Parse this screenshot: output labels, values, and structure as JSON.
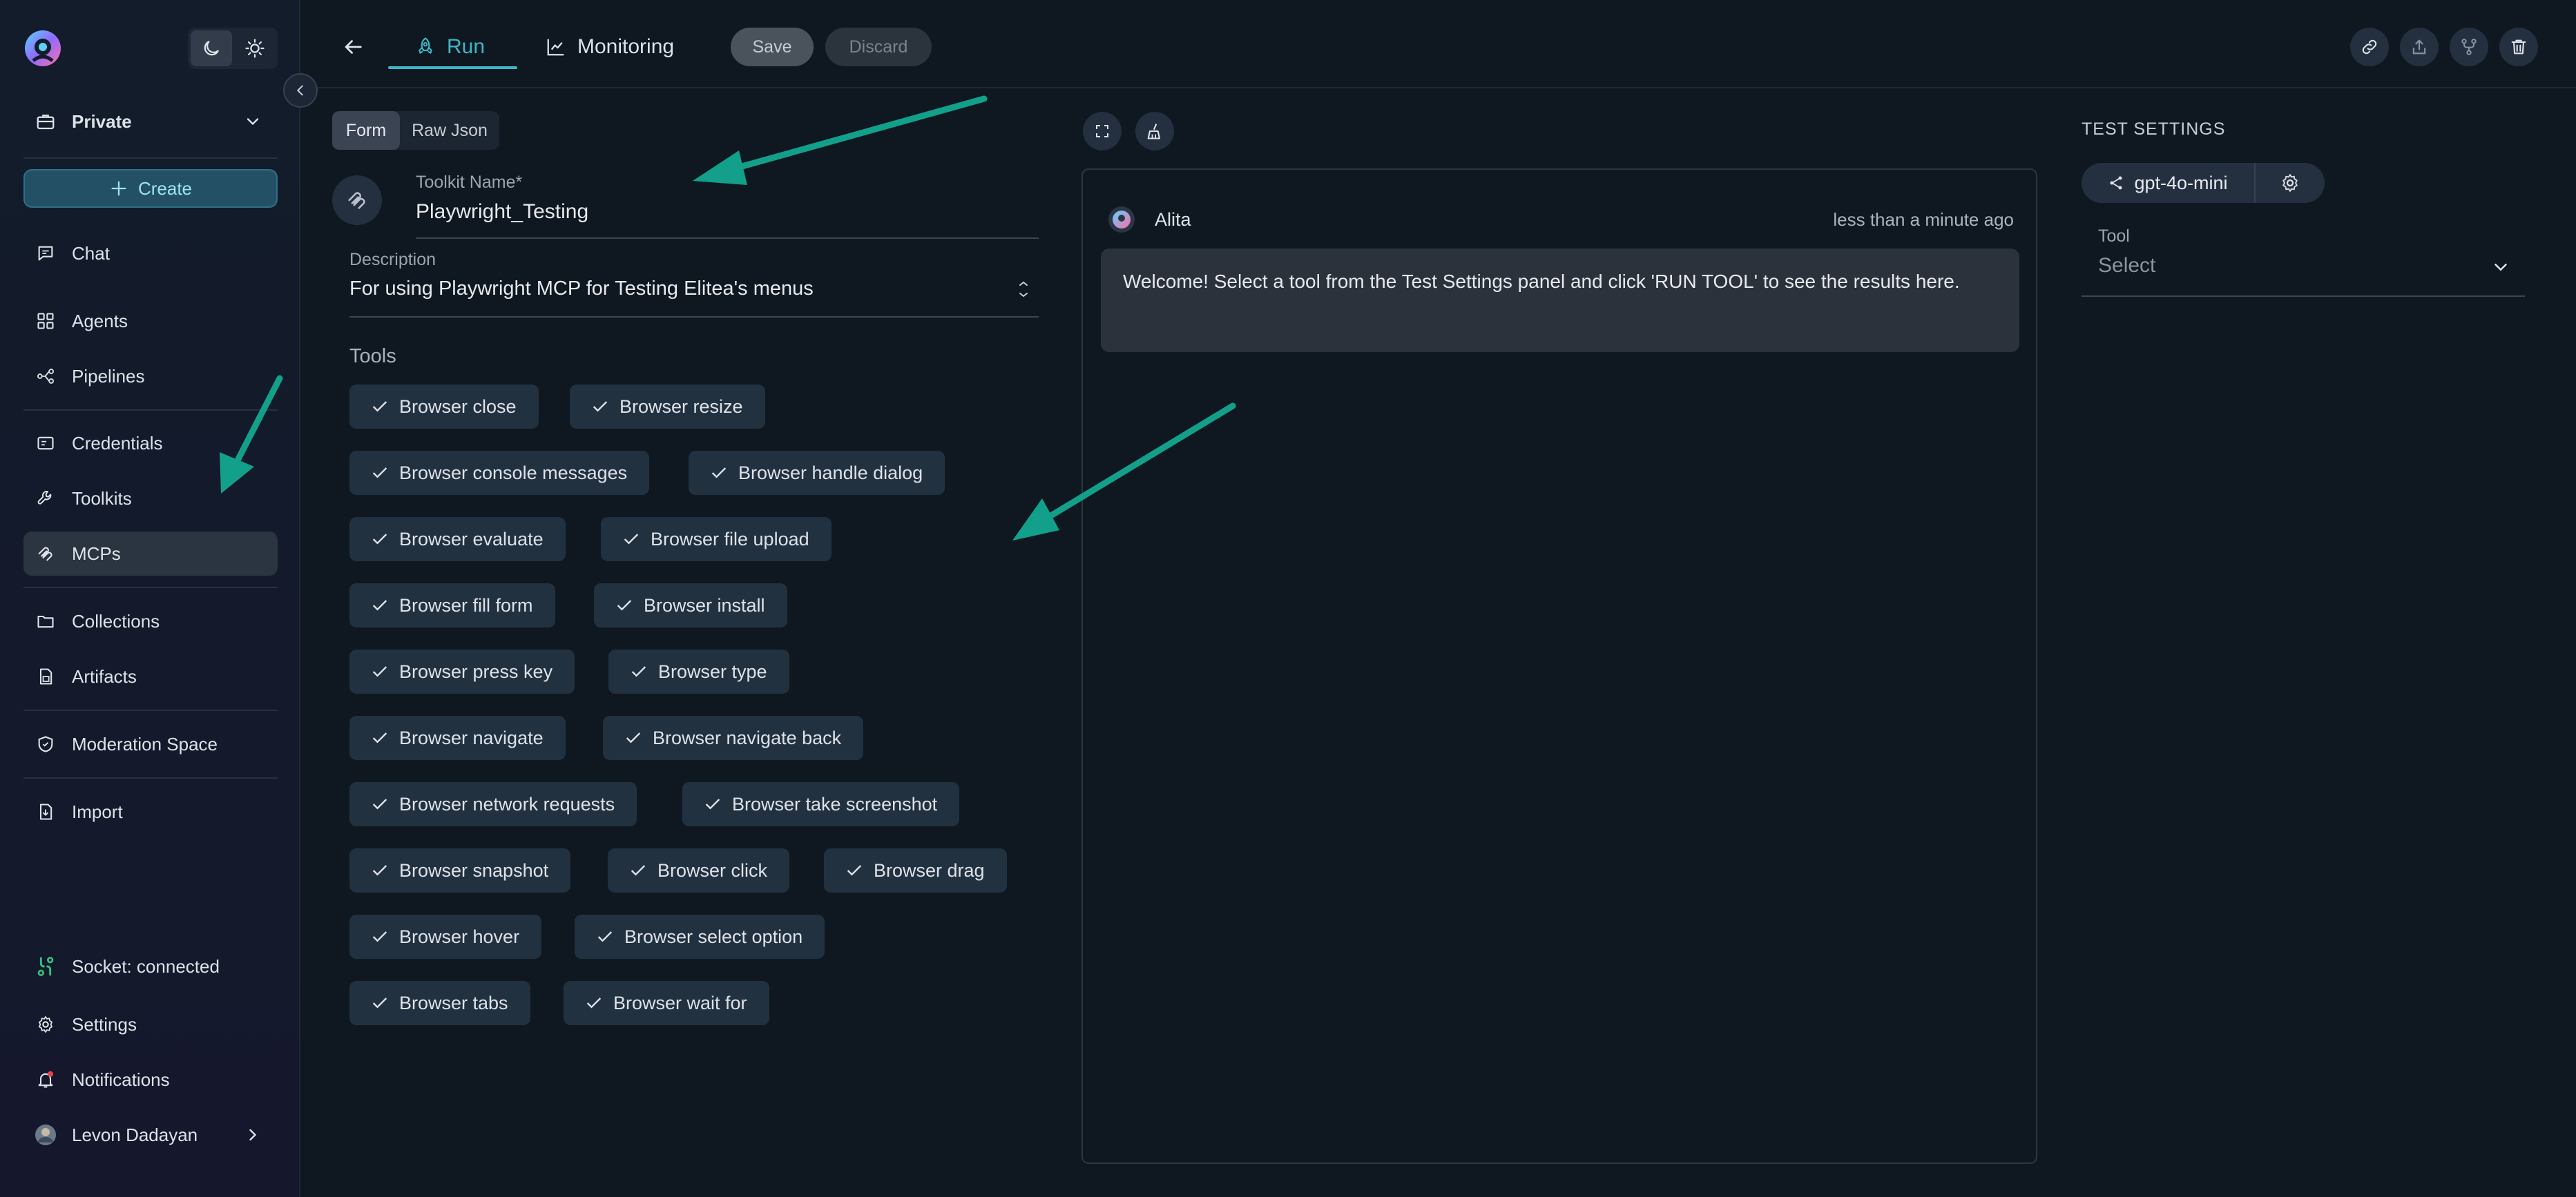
{
  "sidebar": {
    "workspace": "Private",
    "create_label": "Create",
    "items": [
      {
        "label": "Chat",
        "icon": "chat-icon"
      },
      {
        "label": "Agents",
        "icon": "grid-icon"
      },
      {
        "label": "Pipelines",
        "icon": "pipeline-icon"
      },
      {
        "label": "Credentials",
        "icon": "credentials-icon"
      },
      {
        "label": "Toolkits",
        "icon": "wrench-icon"
      },
      {
        "label": "MCPs",
        "icon": "mcp-icon"
      },
      {
        "label": "Collections",
        "icon": "folder-icon"
      },
      {
        "label": "Artifacts",
        "icon": "artifact-icon"
      },
      {
        "label": "Moderation Space",
        "icon": "shield-icon"
      },
      {
        "label": "Import",
        "icon": "import-icon"
      }
    ],
    "socket_status": "Socket: connected",
    "settings_label": "Settings",
    "notifications_label": "Notifications",
    "user_name": "Levon Dadayan"
  },
  "topbar": {
    "tabs": [
      {
        "label": "Run",
        "active": true
      },
      {
        "label": "Monitoring",
        "active": false
      }
    ],
    "save_label": "Save",
    "discard_label": "Discard"
  },
  "form": {
    "mode_tabs": [
      "Form",
      "Raw Json"
    ],
    "toolkit_name_label": "Toolkit Name",
    "toolkit_name_required": "*",
    "toolkit_name_value": "Playwright_Testing",
    "description_label": "Description",
    "description_value": "For using Playwright MCP for Testing Elitea's menus",
    "tools_label": "Tools",
    "tools": [
      [
        "Browser close",
        "Browser resize"
      ],
      [
        "Browser console messages",
        "Browser handle dialog"
      ],
      [
        "Browser evaluate",
        "Browser file upload"
      ],
      [
        "Browser fill form",
        "Browser install"
      ],
      [
        "Browser press key",
        "Browser type"
      ],
      [
        "Browser navigate",
        "Browser navigate back"
      ],
      [
        "Browser network requests",
        "Browser take screenshot"
      ],
      [
        "Browser snapshot",
        "Browser click",
        "Browser drag"
      ],
      [
        "Browser hover",
        "Browser select option"
      ],
      [
        "Browser tabs",
        "Browser wait for"
      ]
    ]
  },
  "chat": {
    "author": "Alita",
    "timestamp": "less than a minute ago",
    "message": "Welcome! Select a tool from the Test Settings panel and click 'RUN TOOL' to see the results here."
  },
  "test_settings": {
    "title": "TEST SETTINGS",
    "model": "gpt-4o-mini",
    "tool_label": "Tool",
    "tool_placeholder": "Select"
  },
  "colors": {
    "accent": "#3fb6c8",
    "arrow": "#13a08a",
    "background": "#0f1820",
    "chip": "#223140"
  }
}
